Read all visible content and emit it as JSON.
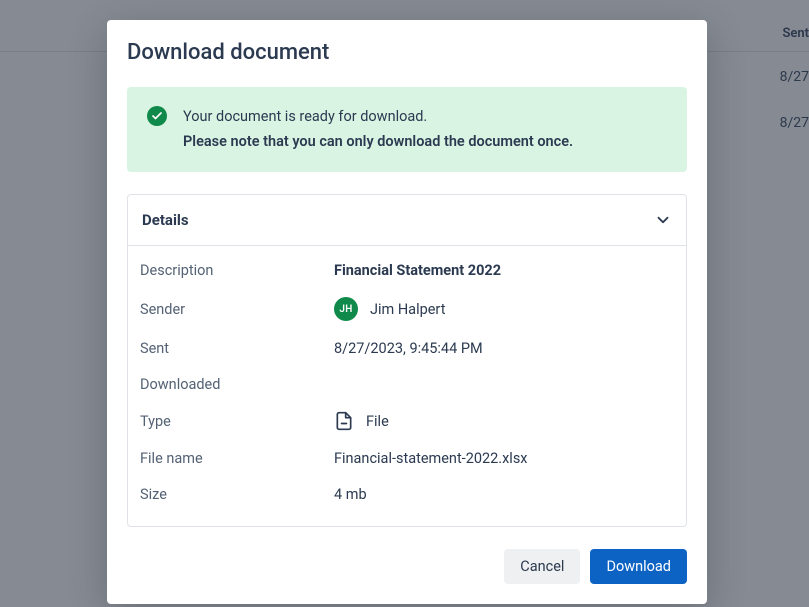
{
  "background": {
    "header": "Sent",
    "row1": "8/27",
    "row2": "8/27"
  },
  "modal": {
    "title": "Download document",
    "alert": {
      "line1": "Your document is ready for download.",
      "line2": "Please note that you can only download the document once."
    },
    "details": {
      "header": "Details",
      "labels": {
        "description": "Description",
        "sender": "Sender",
        "sent": "Sent",
        "downloaded": "Downloaded",
        "type": "Type",
        "filename": "File name",
        "size": "Size"
      },
      "values": {
        "description": "Financial Statement 2022",
        "sender_initials": "JH",
        "sender_name": "Jim Halpert",
        "sent": "8/27/2023, 9:45:44 PM",
        "downloaded": "",
        "type": "File",
        "filename": "Financial-statement-2022.xlsx",
        "size": "4 mb"
      }
    },
    "buttons": {
      "cancel": "Cancel",
      "download": "Download"
    }
  }
}
